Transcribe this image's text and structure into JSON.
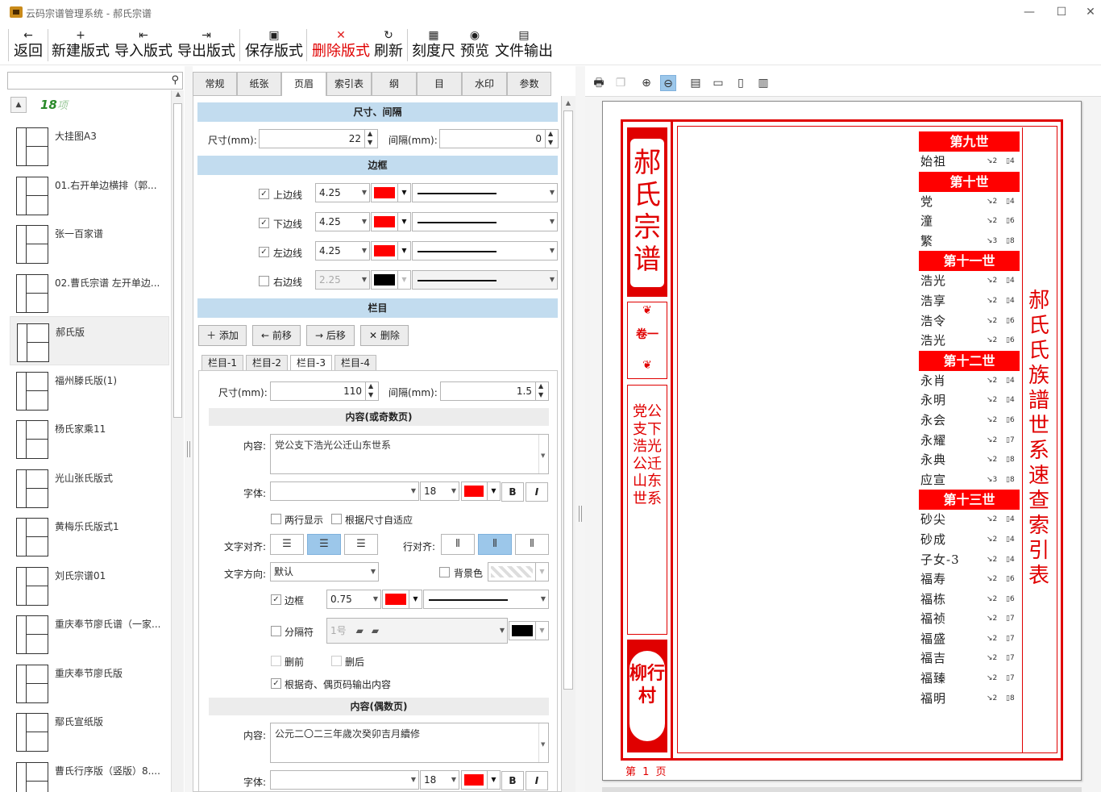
{
  "window": {
    "title": "云码宗谱管理系统 - 郝氏宗谱",
    "minimize": "—",
    "maximize": "☐",
    "close": "✕"
  },
  "toolbar": [
    {
      "icon": "←",
      "label": "返回"
    },
    {
      "icon": "+",
      "label": "新建版式"
    },
    {
      "icon": "⇤",
      "label": "导入版式"
    },
    {
      "icon": "⇥",
      "label": "导出版式"
    },
    {
      "icon": "▣",
      "label": "保存版式"
    },
    {
      "icon": "✕",
      "label": "删除版式"
    },
    {
      "icon": "↻",
      "label": "刷新"
    },
    {
      "icon": "▦",
      "label": "刻度尺"
    },
    {
      "icon": "◉",
      "label": "预览"
    },
    {
      "icon": "▤",
      "label": "文件输出"
    }
  ],
  "left": {
    "search_placeholder": "",
    "count_num": "18",
    "count_unit": "项",
    "items": [
      "大挂图A3",
      "01.右开单边横排（郭...",
      "张一百家谱",
      "02.曹氏宗谱  左开单边...",
      "郝氏版",
      "福州滕氏版(1)",
      "杨氏家乘11",
      "光山张氏版式",
      "黄梅乐氏版式1",
      "刘氏宗谱01",
      "重庆奉节廖氏谱（一家...",
      "重庆奉节廖氏版",
      "鄢氏宣纸版",
      "曹氏行序版（竖版）8...."
    ],
    "selected_index": 4
  },
  "tabs": [
    "常规",
    "纸张",
    "页眉",
    "索引表",
    "纲",
    "目",
    "水印",
    "参数"
  ],
  "active_tab": 2,
  "form": {
    "sec_size": "尺寸、间隔",
    "size_label": "尺寸(mm):",
    "size_value": "22",
    "gap_label": "间隔(mm):",
    "gap_value": "0",
    "sec_border": "边框",
    "borders": [
      {
        "label": "上边线",
        "checked": true,
        "width": "4.25",
        "color": "#ff0000"
      },
      {
        "label": "下边线",
        "checked": true,
        "width": "4.25",
        "color": "#ff0000"
      },
      {
        "label": "左边线",
        "checked": true,
        "width": "4.25",
        "color": "#ff0000"
      },
      {
        "label": "右边线",
        "checked": false,
        "width": "2.25",
        "color": "#000000"
      }
    ],
    "sec_column": "栏目",
    "btn_add": "添加",
    "btn_prev": "前移",
    "btn_next": "后移",
    "btn_del": "删除",
    "col_tabs": [
      "栏目-1",
      "栏目-2",
      "栏目-3",
      "栏目-4"
    ],
    "col_size_label": "尺寸(mm):",
    "col_size_value": "110",
    "col_gap_label": "间隔(mm):",
    "col_gap_value": "1.5",
    "odd_head": "内容(或奇数页)",
    "content_label": "内容:",
    "odd_content": "党公支下浩光公迁山东世系",
    "font_label": "字体:",
    "font_size": "18",
    "two_line": "两行显示",
    "auto_fit": "根据尺寸自适应",
    "align_label": "文字对齐:",
    "line_align_label": "行对齐:",
    "dir_label": "文字方向:",
    "dir_value": "默认",
    "bg_label": "背景色",
    "border_label": "边框",
    "border_width": "0.75",
    "sep_label": "分隔符",
    "sep_value": "1号",
    "del_before": "删前",
    "del_after": "删后",
    "odd_even": "根据奇、偶页码输出内容",
    "even_head": "内容(偶数页)",
    "even_content": "公元二〇二三年歲次癸卯吉月續修",
    "bold": "B",
    "italic": "I"
  },
  "preview": {
    "spine_title": "郝氏宗谱",
    "volume": "卷一",
    "spine_sub": "党公支下浩光公迁山东世系",
    "village": "柳行村",
    "page_num": "第 1 页",
    "right_title": "郝氏氏族譜世系速查索引表",
    "generations": [
      {
        "head": "第九世",
        "rows": [
          [
            "始祖",
            "↘2",
            "▯4"
          ]
        ]
      },
      {
        "head": "第十世",
        "rows": [
          [
            "党",
            "↘2",
            "▯4"
          ],
          [
            "潼",
            "↘2",
            "▯6"
          ],
          [
            "繁",
            "↘3",
            "▯8"
          ]
        ]
      },
      {
        "head": "第十一世",
        "rows": [
          [
            "浩光",
            "↘2",
            "▯4"
          ],
          [
            "浩享",
            "↘2",
            "▯4"
          ],
          [
            "浩令",
            "↘2",
            "▯6"
          ],
          [
            "浩光",
            "↘2",
            "▯6"
          ]
        ]
      },
      {
        "head": "第十二世",
        "rows": [
          [
            "永肖",
            "↘2",
            "▯4"
          ],
          [
            "永明",
            "↘2",
            "▯4"
          ],
          [
            "永会",
            "↘2",
            "▯6"
          ],
          [
            "永耀",
            "↘2",
            "▯7"
          ],
          [
            "永典",
            "↘2",
            "▯8"
          ],
          [
            "应宣",
            "↘3",
            "▯8"
          ]
        ]
      },
      {
        "head": "第十三世",
        "rows": [
          [
            "砂尖",
            "↘2",
            "▯4"
          ],
          [
            "砂成",
            "↘2",
            "▯4"
          ],
          [
            "子女-3",
            "↘2",
            "▯4"
          ],
          [
            "福寿",
            "↘2",
            "▯6"
          ],
          [
            "福栋",
            "↘2",
            "▯6"
          ],
          [
            "福祯",
            "↘2",
            "▯7"
          ],
          [
            "福盛",
            "↘2",
            "▯7"
          ],
          [
            "福吉",
            "↘2",
            "▯7"
          ],
          [
            "福臻",
            "↘2",
            "▯7"
          ],
          [
            "福明",
            "↘2",
            "▯8"
          ]
        ]
      }
    ]
  },
  "colors": {
    "accent": "#ff0000",
    "section": "#c2dcef",
    "active": "#9cc7ea"
  }
}
